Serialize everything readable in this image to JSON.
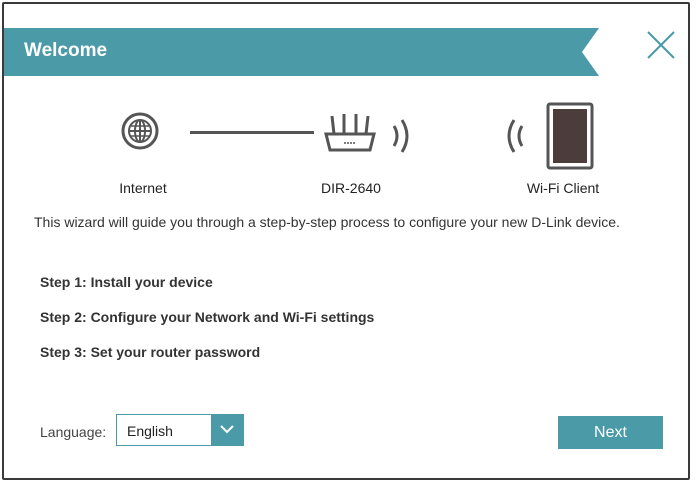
{
  "dialog": {
    "title": "Welcome",
    "accent_color": "#4a9aa8"
  },
  "diagram": {
    "internet_label": "Internet",
    "router_label": "DIR-2640",
    "client_label": "Wi-Fi Client"
  },
  "intro_text": "This wizard will guide you through a step-by-step process to configure your new D-Link device.",
  "steps": [
    "Step 1: Install your device",
    "Step 2: Configure your Network and Wi-Fi settings",
    "Step 3: Set your router password"
  ],
  "language": {
    "label": "Language:",
    "selected": "English"
  },
  "next_label": "Next",
  "icons": [
    "globe-icon",
    "router-icon",
    "wifi-signal-icon",
    "tablet-icon",
    "close-icon",
    "chevron-down-icon"
  ]
}
